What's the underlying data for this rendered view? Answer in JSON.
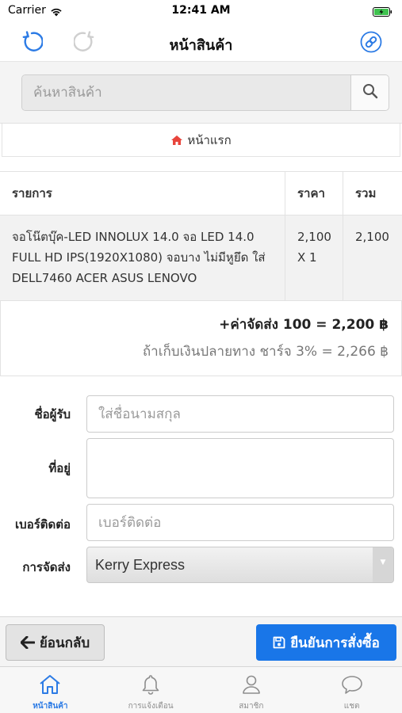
{
  "status_bar": {
    "carrier": "Carrier",
    "time": "12:41 AM"
  },
  "navbar": {
    "title": "หน้าสินค้า",
    "left_icons": [
      "refresh-icon",
      "redo-icon"
    ],
    "right_icon": "link-icon"
  },
  "search": {
    "placeholder": "ค้นหาสินค้า",
    "value": ""
  },
  "breadcrumb": {
    "label": "หน้าแรก",
    "icon": "home-icon"
  },
  "table": {
    "headers": {
      "item": "รายการ",
      "price": "ราคา",
      "total": "รวม"
    },
    "rows": [
      {
        "item": "จอโน๊ตบุ๊ค-LED INNOLUX 14.0 จอ LED 14.0 FULL HD IPS(1920X1080) จอบาง ไม่มีหูยึด ใส่ DELL7460 ACER ASUS LENOVO",
        "price": "2,100",
        "qty": "X 1",
        "total": "2,100"
      }
    ]
  },
  "totals": {
    "shipping_line": "+ค่าจัดส่ง 100 = 2,200 ฿",
    "cod_line": "ถ้าเก็บเงินปลายทาง ชาร์จ 3% = 2,266 ฿"
  },
  "form": {
    "name_label": "ชื่อผู้รับ",
    "name_placeholder": "ใส่ชื่อนามสกุล",
    "address_label": "ที่อยู่",
    "address_value": "",
    "phone_label": "เบอร์ติดต่อ",
    "phone_placeholder": "เบอร์ติดต่อ",
    "shipping_label": "การจัดส่ง",
    "shipping_value": "Kerry Express"
  },
  "actions": {
    "back_label": "ย้อนกลับ",
    "confirm_label": "ยืนยันการสั่งซื้อ"
  },
  "tabbar": {
    "items": [
      {
        "label": "หน้าสินค้า",
        "icon": "home-icon",
        "active": true
      },
      {
        "label": "การแจ้งเตือน",
        "icon": "bell-icon",
        "active": false
      },
      {
        "label": "สมาชิก",
        "icon": "user-icon",
        "active": false
      },
      {
        "label": "แชต",
        "icon": "chat-icon",
        "active": false
      }
    ]
  },
  "colors": {
    "accent": "#1976e8",
    "home_red": "#e8453c",
    "tab_active": "#2c7be5"
  }
}
